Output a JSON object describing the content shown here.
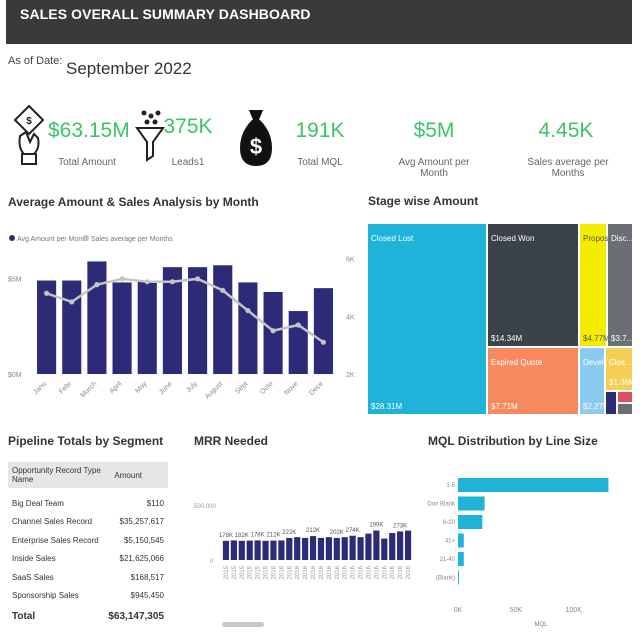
{
  "header": {
    "title": "SALES OVERALL SUMMARY DASHBOARD"
  },
  "as_of": {
    "label": "As of Date:",
    "value": "September 2022"
  },
  "kpis": [
    {
      "value": "$63.15M",
      "label": "Total Amount",
      "icon": "hand-money-icon"
    },
    {
      "value": "375K",
      "label": "Leads1",
      "icon": "funnel-icon"
    },
    {
      "value": "191K",
      "label": "Total MQL",
      "icon": "money-bag-icon"
    },
    {
      "value": "$5M",
      "label": "Avg Amount per Month"
    },
    {
      "value": "4.45K",
      "label": "Sales average per Months"
    }
  ],
  "colors": {
    "accent_green": "#3ec26a",
    "bar_navy": "#2d2a78",
    "line_gray": "#c4c4c4",
    "header_bg": "#3a3a3a"
  },
  "chart_data": [
    {
      "type": "bar",
      "title": "Average Amount & Sales Analysis by Month",
      "legend": [
        "Avg Amount per Month",
        "Sales average per Months"
      ],
      "legend_position": "top-left",
      "categories": [
        "Janu",
        "Febr",
        "March",
        "April",
        "May",
        "June",
        "July",
        "August",
        "Sept",
        "Octo",
        "Nove",
        "Dece"
      ],
      "series": [
        {
          "name": "Avg Amount per Month",
          "type": "bar",
          "axis": "left",
          "values": [
            4.9,
            4.9,
            5.9,
            4.8,
            4.9,
            5.6,
            5.6,
            5.7,
            4.8,
            4.3,
            3.3,
            4.5
          ]
        },
        {
          "name": "Sales average per Months",
          "type": "line",
          "axis": "right",
          "values": [
            4.8,
            4.5,
            5.1,
            5.3,
            5.2,
            5.2,
            5.3,
            4.9,
            4.2,
            3.5,
            3.7,
            3.1
          ]
        }
      ],
      "y_left_ticks": [
        "$0M",
        "$5M"
      ],
      "y_left_lim": [
        0,
        6.5
      ],
      "y_right_ticks": [
        "2K",
        "4K",
        "6K"
      ],
      "y_right_lim": [
        2,
        6.3
      ]
    },
    {
      "type": "treemap",
      "title": "Stage wise Amount",
      "items": [
        {
          "label": "Closed Lost",
          "value_label": "$28.31M",
          "color": "#1fb3d9"
        },
        {
          "label": "Closed Won",
          "value_label": "$14.34M",
          "color": "#3c4249"
        },
        {
          "label": "Expired Quote",
          "value_label": "$7.71M",
          "color": "#f7895f"
        },
        {
          "label": "Proposal",
          "value_label": "$4.77M",
          "color": "#f5ed00"
        },
        {
          "label": "Disc...",
          "value_label": "$3.7...",
          "color": "#6b6e73"
        },
        {
          "label": "Devel...",
          "value_label": "$2.27M",
          "color": "#8ccbf0"
        },
        {
          "label": "Clos...",
          "value_label": "$1.36M",
          "color": "#f5cf55"
        }
      ]
    },
    {
      "type": "table",
      "title": "Pipeline Totals by Segment",
      "columns": [
        "Opportunity Record Type Name",
        "Amount"
      ],
      "rows": [
        [
          "Big Deal Team",
          "$110"
        ],
        [
          "Channel Sales Record",
          "$35,257,617"
        ],
        [
          "Enterprise Sales Record",
          "$5,150,545"
        ],
        [
          "Inside Sales",
          "$21,625,066"
        ],
        [
          "SaaS Sales",
          "$168,517"
        ],
        [
          "Sponsorship Sales",
          "$945,450"
        ]
      ],
      "total": [
        "Total",
        "$63,147,305"
      ]
    },
    {
      "type": "bar",
      "title": "MRR Needed",
      "y_tick": "500,000",
      "y_zero": "0",
      "categories": [
        "2015",
        "2015",
        "2015",
        "2015",
        "2015",
        "2015",
        "2016",
        "2016",
        "2016",
        "2016",
        "2016",
        "2016",
        "2016",
        "2016",
        "2016",
        "2016",
        "2016",
        "2016",
        "2016",
        "2016",
        "2016",
        "2016",
        "2016",
        "2016"
      ],
      "values": [
        178,
        182,
        178,
        180,
        182,
        178,
        180,
        182,
        205,
        212,
        205,
        222,
        205,
        212,
        205,
        212,
        225,
        212,
        245,
        274,
        199,
        250,
        265,
        273
      ],
      "data_labels": [
        "178K",
        "182K",
        "178K",
        "212K",
        "222K",
        "212K",
        "202K",
        "274K",
        "199K",
        "273K"
      ],
      "ylim": [
        0,
        520
      ]
    },
    {
      "type": "bar",
      "orientation": "horizontal",
      "title": "MQL Distribution by Line Size",
      "categories": [
        "1-5",
        "Don Blank",
        "6-20",
        "41+",
        "21-40",
        "(Blank)"
      ],
      "values": [
        130000,
        23000,
        21000,
        5000,
        5000,
        800
      ],
      "x_ticks": [
        "0K",
        "50K",
        "100K"
      ],
      "xlabel": "MQL",
      "xlim": [
        0,
        140000
      ]
    }
  ]
}
